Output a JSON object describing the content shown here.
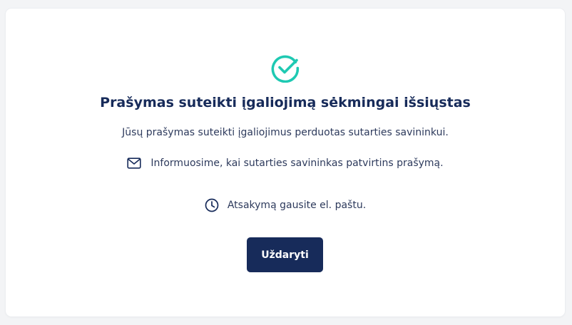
{
  "colors": {
    "accent": "#1ec9b2",
    "primary": "#172b5a",
    "text": "#2d3a5c",
    "card_bg": "#ffffff",
    "page_bg": "#f3f4f6"
  },
  "dialog": {
    "status_icon": "check-circle-icon",
    "title": "Prašymas suteikti įgaliojimą sėkmingai išsiųstas",
    "subtitle": "Jūsų prašymas suteikti įgaliojimus perduotas sutarties savininkui.",
    "info_items": [
      {
        "icon": "mail-icon",
        "text": "Informuosime, kai sutarties savininkas patvirtins prašymą."
      },
      {
        "icon": "clock-icon",
        "text": "Atsakymą gausite el. paštu."
      }
    ],
    "close_button_label": "Uždaryti"
  }
}
